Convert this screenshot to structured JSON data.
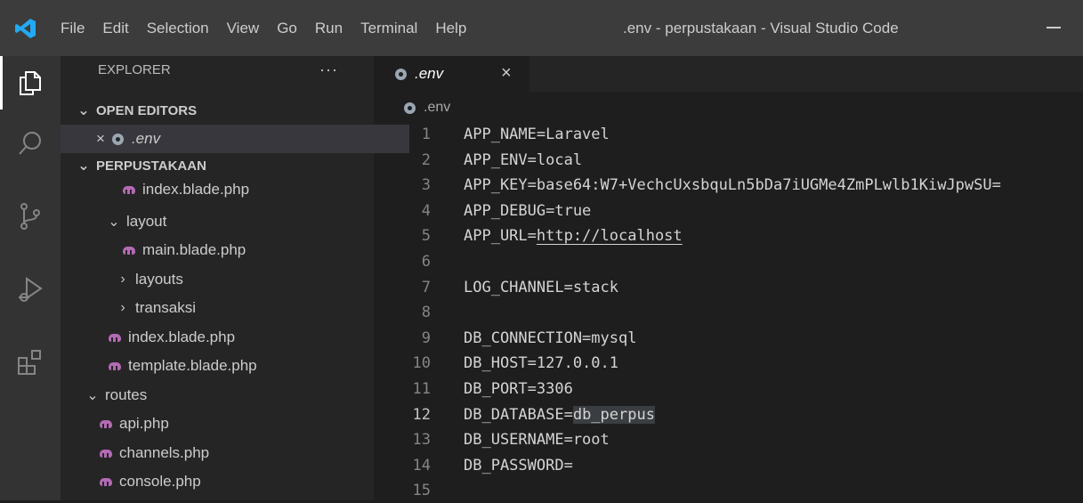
{
  "titlebar": {
    "menu": [
      "File",
      "Edit",
      "Selection",
      "View",
      "Go",
      "Run",
      "Terminal",
      "Help"
    ],
    "window_title": ".env - perpustakaan - Visual Studio Code"
  },
  "activity_bar": {
    "icons": [
      "explorer-icon",
      "search-icon",
      "source-control-icon",
      "run-debug-icon",
      "extensions-icon"
    ]
  },
  "sidebar": {
    "header": "EXPLORER",
    "more": "···",
    "open_editors_label": "OPEN EDITORS",
    "open_editor_file": ".env",
    "project_label": "PERPUSTAKAAN",
    "tree": [
      {
        "label": "index.blade.php",
        "type": "file"
      },
      {
        "label": "layout",
        "type": "folder-open"
      },
      {
        "label": "main.blade.php",
        "type": "file"
      },
      {
        "label": "layouts",
        "type": "folder-closed"
      },
      {
        "label": "transaksi",
        "type": "folder-closed"
      },
      {
        "label": "index.blade.php",
        "type": "file"
      },
      {
        "label": "template.blade.php",
        "type": "file"
      },
      {
        "label": "routes",
        "type": "folder-open"
      },
      {
        "label": "api.php",
        "type": "file"
      },
      {
        "label": "channels.php",
        "type": "file"
      },
      {
        "label": "console.php",
        "type": "file"
      }
    ]
  },
  "editor": {
    "tab_label": ".env",
    "tab_close": "×",
    "breadcrumb": ".env",
    "active_line": 12,
    "lines": [
      {
        "n": "1",
        "text": "APP_NAME=Laravel"
      },
      {
        "n": "2",
        "text": "APP_ENV=local"
      },
      {
        "n": "3",
        "text": "APP_KEY=base64:W7+VechcUxsbquLn5bDa7iUGMe4ZmPLwlb1KiwJpwSU="
      },
      {
        "n": "4",
        "text": "APP_DEBUG=true"
      },
      {
        "n": "5",
        "text": "APP_URL=",
        "url": "http://localhost"
      },
      {
        "n": "6",
        "text": ""
      },
      {
        "n": "7",
        "text": "LOG_CHANNEL=stack"
      },
      {
        "n": "8",
        "text": ""
      },
      {
        "n": "9",
        "text": "DB_CONNECTION=mysql"
      },
      {
        "n": "10",
        "text": "DB_HOST=127.0.0.1"
      },
      {
        "n": "11",
        "text": "DB_PORT=3306"
      },
      {
        "n": "12",
        "text": "DB_DATABASE=",
        "highlight": "db_perpus"
      },
      {
        "n": "13",
        "text": "DB_USERNAME=root"
      },
      {
        "n": "14",
        "text": "DB_PASSWORD="
      },
      {
        "n": "15",
        "text": ""
      }
    ]
  },
  "colors": {
    "titlebar": "#3c3c3c",
    "activity_bar": "#333333",
    "sidebar": "#252526",
    "editor": "#1e1e1e",
    "vscode_blue": "#23a9f2",
    "php_icon": "#b36ab3"
  }
}
